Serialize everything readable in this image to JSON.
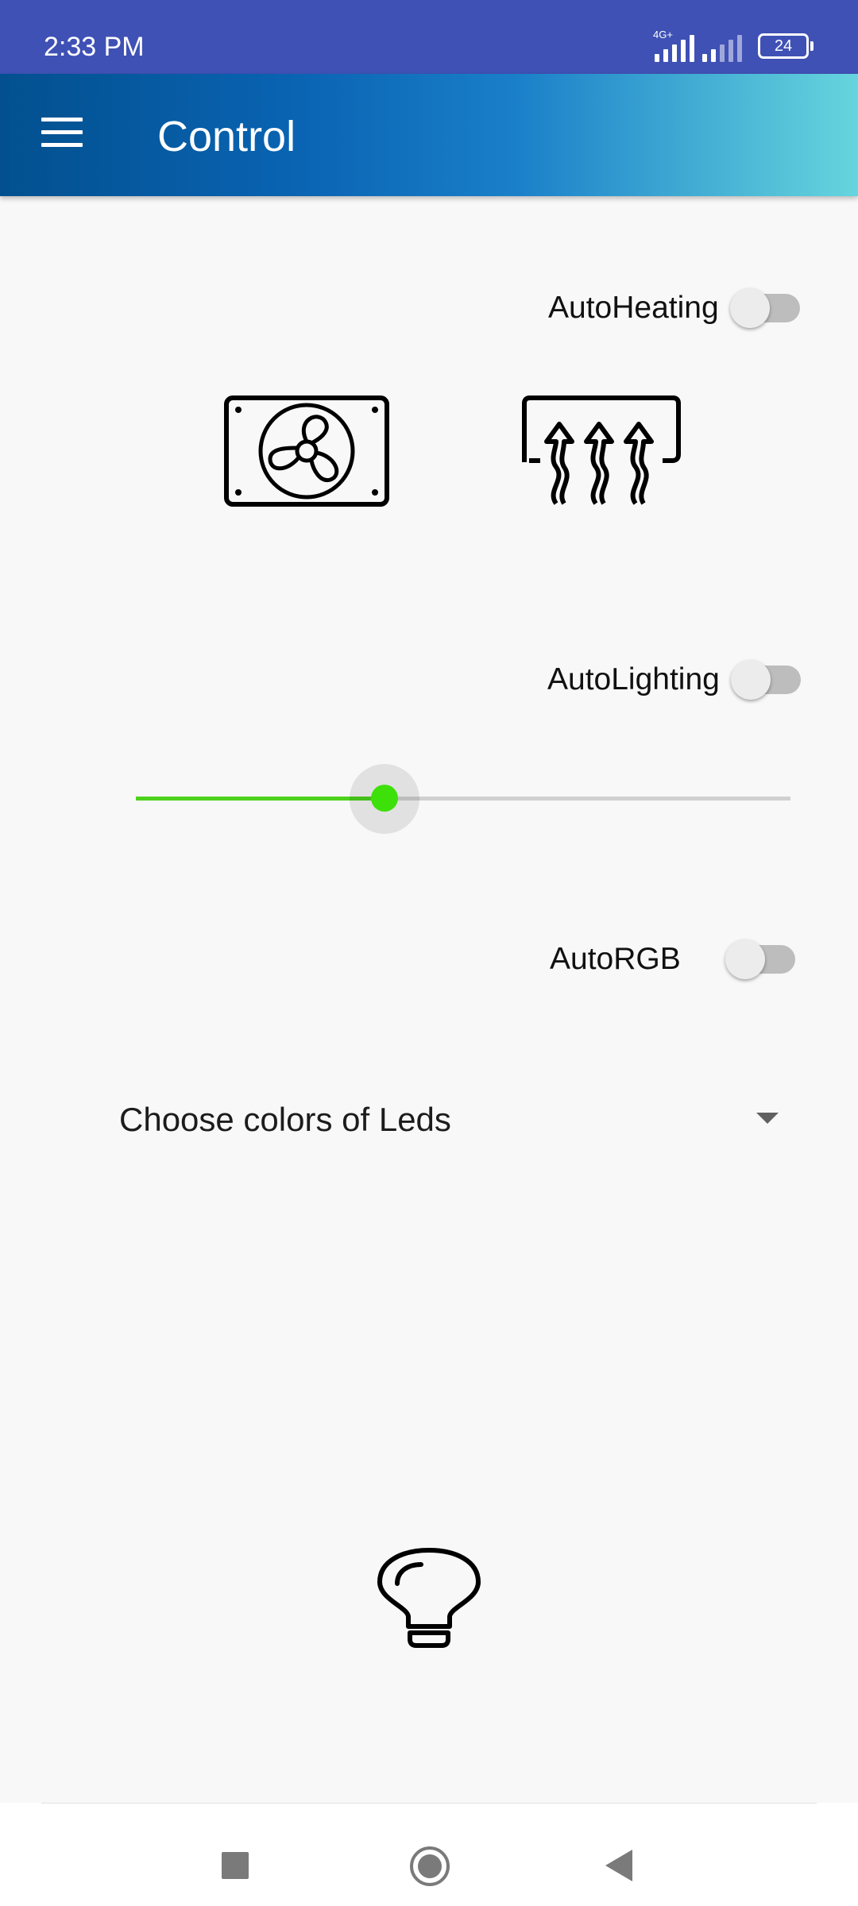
{
  "status_bar": {
    "time": "2:33 PM",
    "network_type": "4G+",
    "battery_level": "24",
    "icons": [
      "signal-4g-icon",
      "signal-icon",
      "battery-icon"
    ]
  },
  "app_bar": {
    "title": "Control",
    "menu_icon": "menu-icon"
  },
  "heating": {
    "switch_label": "AutoHeating",
    "switch_on": false,
    "devices": [
      "fan-icon",
      "heater-icon"
    ]
  },
  "lighting": {
    "switch_label": "AutoLighting",
    "switch_on": false,
    "brightness_fraction": 0.38,
    "accent_color": "#3ee00a"
  },
  "rgb": {
    "switch_label": "AutoRGB",
    "switch_on": false,
    "color_select": {
      "selected": "Choose colors of Leds"
    },
    "bulb_icon": "light-bulb-icon"
  },
  "nav_bar": {
    "buttons": [
      "recents-button",
      "home-button",
      "back-button"
    ]
  },
  "colors": {
    "status_bar": "#3f51b5",
    "app_bar_gradient_start": "#02508f",
    "app_bar_gradient_end": "#66d5dd",
    "slider_active": "#4cd21c",
    "background": "#f8f8f8"
  }
}
